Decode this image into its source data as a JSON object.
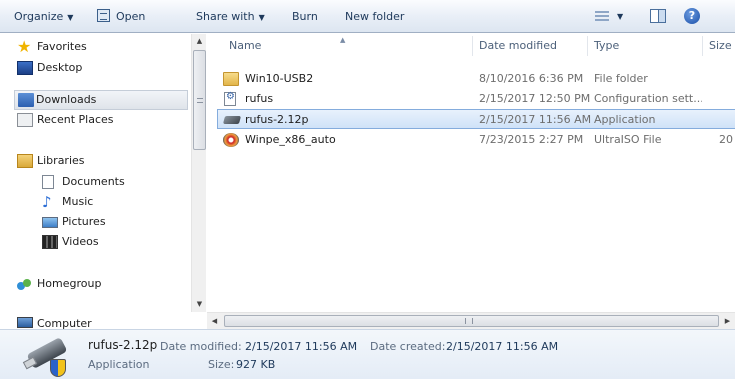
{
  "toolbar": {
    "organize": "Organize",
    "open": "Open",
    "share_with": "Share with",
    "burn": "Burn",
    "new_folder": "New folder"
  },
  "nav": {
    "favorites": "Favorites",
    "desktop": "Desktop",
    "downloads": "Downloads",
    "recent_places": "Recent Places",
    "libraries": "Libraries",
    "documents": "Documents",
    "music": "Music",
    "pictures": "Pictures",
    "videos": "Videos",
    "homegroup": "Homegroup",
    "computer": "Computer"
  },
  "columns": {
    "name": "Name",
    "date_modified": "Date modified",
    "type": "Type",
    "size": "Size"
  },
  "files": [
    {
      "name": "Win10-USB2",
      "date": "8/10/2016 6:36 PM",
      "type": "File folder",
      "size": "",
      "icon": "folder-icon"
    },
    {
      "name": "rufus",
      "date": "2/15/2017 12:50 PM",
      "type": "Configuration sett...",
      "size": "",
      "icon": "config-file-icon"
    },
    {
      "name": "rufus-2.12p",
      "date": "2/15/2017 11:56 AM",
      "type": "Application",
      "size": "",
      "icon": "usb-app-icon",
      "selected": true
    },
    {
      "name": "Winpe_x86_auto",
      "date": "7/23/2015 2:27 PM",
      "type": "UltraISO File",
      "size": "20",
      "icon": "iso-file-icon"
    }
  ],
  "details": {
    "name": "rufus-2.12p",
    "type": "Application",
    "date_modified_label": "Date modified:",
    "date_modified": "2/15/2017 11:56 AM",
    "date_created_label": "Date created:",
    "date_created": "2/15/2017 11:56 AM",
    "size_label": "Size:",
    "size": "927 KB"
  },
  "scrollbar": {
    "h_grip": "III"
  }
}
